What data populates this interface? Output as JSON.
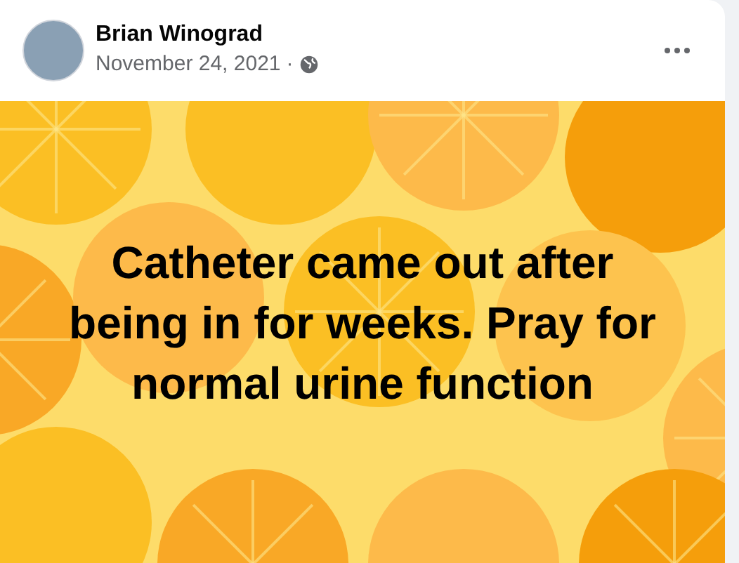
{
  "post": {
    "author": "Brian Winograd",
    "date": "November 24, 2021",
    "separator": "·",
    "message": "Catheter came out after being in for weeks. Pray for normal urine function"
  }
}
